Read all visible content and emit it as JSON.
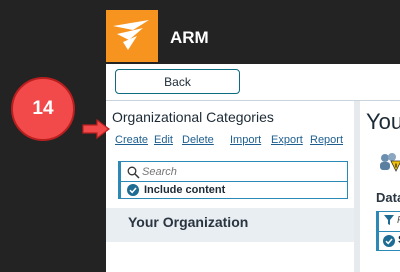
{
  "app": {
    "title": "ARM"
  },
  "toolbar": {
    "back_label": "Back"
  },
  "left_panel": {
    "title": "Organizational Categories",
    "actions": [
      "Create",
      "Edit",
      "Delete",
      "Import",
      "Export",
      "Report"
    ],
    "search_placeholder": "Search",
    "include_content_label": "Include content",
    "tree_items": [
      "Your Organization"
    ]
  },
  "right_panel": {
    "title_partial": "You",
    "section_partial": "Data",
    "filter_placeholder_partial": "F",
    "filter_option_partial": "S"
  },
  "callout": {
    "step_number": "14"
  },
  "colors": {
    "brand": "#f79420",
    "accent": "#2c89b5",
    "callout": "#f24a4a"
  },
  "icons": [
    "solarwinds-logo-icon",
    "search-icon",
    "check-circle-icon",
    "users-warning-icon",
    "filter-icon",
    "arrow-right-icon"
  ]
}
